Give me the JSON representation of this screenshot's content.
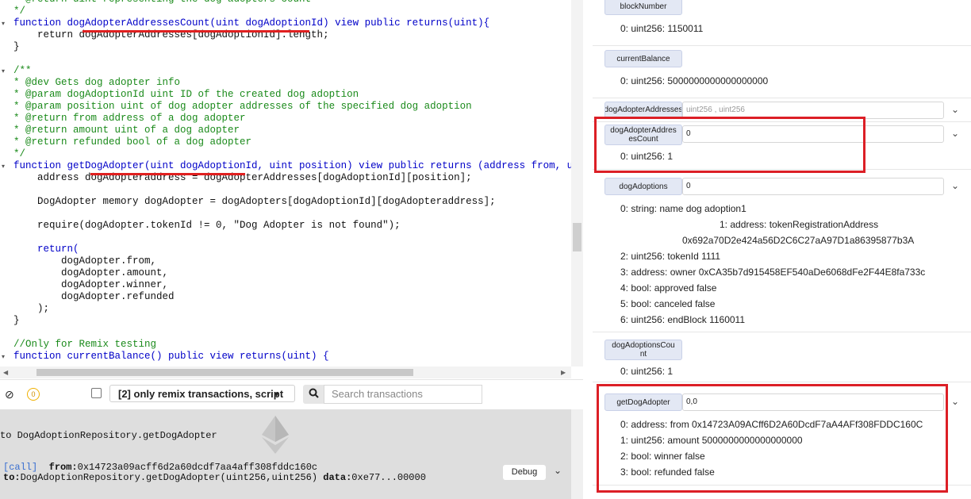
{
  "editor": {
    "lines": [
      {
        "text": "* @return uint representing the dog adopters count",
        "style": "comment"
      },
      {
        "text": "*/",
        "style": "comment"
      },
      {
        "text": "function dogAdopterAddressesCount(uint dogAdoptionId) view public returns(uint){",
        "style": "kw"
      },
      {
        "text": "    return dogAdopterAddresses[dogAdoptionId].length;",
        "style": "plain"
      },
      {
        "text": "}",
        "style": "plain"
      },
      {
        "text": "",
        "style": "plain"
      },
      {
        "text": "/**",
        "style": "comment"
      },
      {
        "text": "* @dev Gets dog adopter info",
        "style": "comment"
      },
      {
        "text": "* @param dogAdoptionId uint ID of the created dog adoption",
        "style": "comment"
      },
      {
        "text": "* @param position uint of dog adopter addresses of the specified dog adoption",
        "style": "comment"
      },
      {
        "text": "* @return from address of a dog adopter",
        "style": "comment"
      },
      {
        "text": "* @return amount uint of a dog adopter",
        "style": "comment"
      },
      {
        "text": "* @return refunded bool of a dog adopter",
        "style": "comment"
      },
      {
        "text": "*/",
        "style": "comment"
      },
      {
        "text": "function getDogAdopter(uint dogAdoptionId, uint position) view public returns (address from, uint a",
        "style": "kw"
      },
      {
        "text": "    address dogAdopteraddress = dogAdopterAddresses[dogAdoptionId][position];",
        "style": "plain"
      },
      {
        "text": "",
        "style": "plain"
      },
      {
        "text": "    DogAdopter memory dogAdopter = dogAdopters[dogAdoptionId][dogAdopteraddress];",
        "style": "plain"
      },
      {
        "text": "",
        "style": "plain"
      },
      {
        "text": "    require(dogAdopter.tokenId != 0, \"Dog Adopter is not found\");",
        "style": "plain"
      },
      {
        "text": "",
        "style": "plain"
      },
      {
        "text": "    return(",
        "style": "kw"
      },
      {
        "text": "        dogAdopter.from,",
        "style": "plain"
      },
      {
        "text": "        dogAdopter.amount,",
        "style": "plain"
      },
      {
        "text": "        dogAdopter.winner,",
        "style": "plain"
      },
      {
        "text": "        dogAdopter.refunded",
        "style": "plain"
      },
      {
        "text": "    );",
        "style": "plain"
      },
      {
        "text": "}",
        "style": "plain"
      },
      {
        "text": "",
        "style": "plain"
      },
      {
        "text": "//Only for Remix testing",
        "style": "comment"
      },
      {
        "text": "function currentBalance() public view returns(uint) {",
        "style": "kw"
      }
    ]
  },
  "terminal": {
    "pending_count": "0",
    "filter_label": "[2] only remix transactions, script",
    "search_placeholder": "Search transactions",
    "log_line1": "to DogAdoptionRepository.getDogAdopter",
    "call_badge": "[call]",
    "from_label": "from:",
    "from_value": "0x14723a09acff6d2a60dcdf7aa4aff308fddc160c",
    "to_label": "to:",
    "to_value": "DogAdoptionRepository.getDogAdopter(uint256,uint256)",
    "data_label": "data:",
    "data_value": "0xe77...00000",
    "debug_label": "Debug"
  },
  "panel": {
    "blockNumber": {
      "label": "blockNumber",
      "output": "0: uint256: 1150011"
    },
    "currentBalance": {
      "label": "currentBalance",
      "output": "0: uint256: 5000000000000000000"
    },
    "dogAdopterAddresses": {
      "label": "dogAdopterAddresses",
      "placeholder": "uint256 , uint256"
    },
    "dogAdopterAddressesCount": {
      "label": "dogAdopterAddresesCount",
      "input": "0",
      "output": "0: uint256: 1"
    },
    "dogAdoptions": {
      "label": "dogAdoptions",
      "input": "0",
      "outputs": [
        "0: string: name dog adoption1",
        "1: address: tokenRegistrationAddress",
        "0x692a70D2e424a56D2C6C27aA97D1a86395877b3A",
        "2: uint256: tokenId 1111",
        "3: address: owner 0xCA35b7d915458EF540aDe6068dFe2F44E8fa733c",
        "4: bool: approved false",
        "5: bool: canceled false",
        "6: uint256: endBlock 1160011"
      ]
    },
    "dogAdoptionsCount": {
      "label": "dogAdoptionsCount",
      "output": "0: uint256: 1"
    },
    "getDogAdopter": {
      "label": "getDogAdopter",
      "input": "0,0",
      "outputs": [
        "0: address: from 0x14723A09ACff6D2A60DcdF7aA4AFf308FDDC160C",
        "1: uint256: amount 5000000000000000000",
        "2: bool: winner false",
        "3: bool: refunded false"
      ]
    }
  },
  "colors": {
    "highlight": "#dc1f26",
    "button_bg": "#e3e8f4",
    "comment": "#1a8a1a",
    "keyword": "#0000c8"
  }
}
